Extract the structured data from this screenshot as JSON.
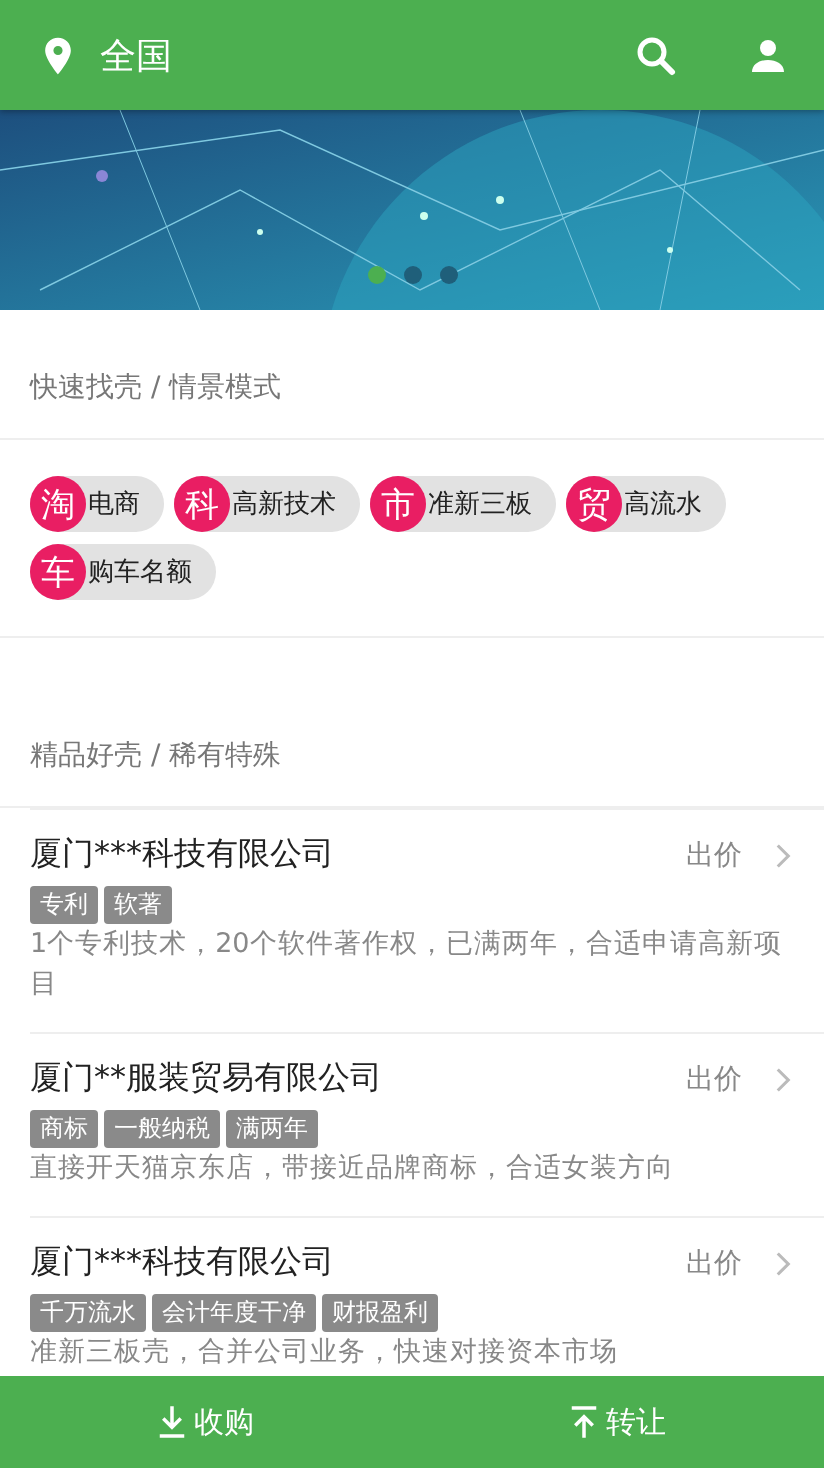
{
  "header": {
    "location": "全国"
  },
  "banner": {
    "dots": [
      {
        "selected": true
      },
      {
        "selected": false
      },
      {
        "selected": false
      }
    ]
  },
  "scenes": {
    "title": "快速找壳 / 情景模式",
    "items": [
      {
        "badge": "淘",
        "label": "电商"
      },
      {
        "badge": "科",
        "label": "高新技术"
      },
      {
        "badge": "市",
        "label": "准新三板"
      },
      {
        "badge": "贸",
        "label": "高流水"
      },
      {
        "badge": "车",
        "label": "购车名额"
      }
    ]
  },
  "listings": {
    "title": "精品好壳 / 稀有特殊",
    "items": [
      {
        "name": "厦门***科技有限公司",
        "action": "出价",
        "tags": [
          "专利",
          "软著"
        ],
        "description": "1个专利技术，20个软件著作权，已满两年，合适申请高新项目"
      },
      {
        "name": "厦门**服装贸易有限公司",
        "action": "出价",
        "tags": [
          "商标",
          "一般纳税",
          "满两年"
        ],
        "description": "直接开天猫京东店，带接近品牌商标，合适女装方向"
      },
      {
        "name": "厦门***科技有限公司",
        "action": "出价",
        "tags": [
          "千万流水",
          "会计年度干净",
          "财报盈利"
        ],
        "description": "准新三板壳，合并公司业务，快速对接资本市场"
      }
    ]
  },
  "bottom_bar": [
    {
      "kind": "buy",
      "label": "收购"
    },
    {
      "kind": "sell",
      "label": "转让"
    }
  ]
}
